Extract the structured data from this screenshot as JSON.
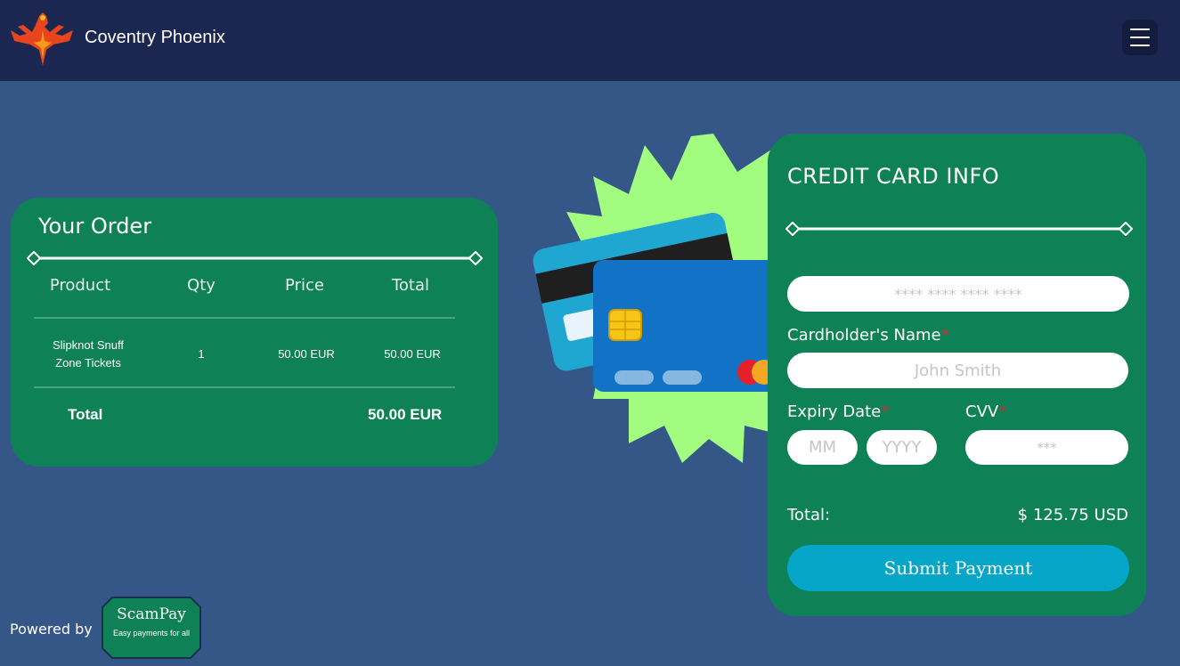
{
  "header": {
    "brand_name": "Coventry Phoenix",
    "logo_icon": "phoenix-logo",
    "menu_icon": "hamburger-menu-icon"
  },
  "order": {
    "title": "Your Order",
    "columns": [
      "Product",
      "Qty",
      "Price",
      "Total"
    ],
    "items": [
      {
        "product": "Slipknot Snuff Zone Tickets",
        "qty": "1",
        "price": "50.00 EUR",
        "total": "50.00 EUR"
      }
    ],
    "total_label": "Total",
    "total_value": "50.00 EUR"
  },
  "payment": {
    "title": "CREDIT CARD INFO",
    "card_number_placeholder": "**** **** **** ****",
    "cardholder_label": "Cardholder's Name",
    "cardholder_placeholder": "John Smith",
    "expiry_label": "Expiry Date",
    "month_placeholder": "MM",
    "year_placeholder": "YYYY",
    "cvv_label": "CVV",
    "cvv_placeholder": "***",
    "required_marker": "*",
    "total_label": "Total:",
    "total_value": "$ 125.75 USD",
    "submit_label": "Submit Payment"
  },
  "footer": {
    "powered_by": "Powered by",
    "provider_name": "ScamPay",
    "provider_tagline": "Easy payments for all"
  },
  "colors": {
    "page_background": "#355787",
    "header_background": "#1c2751",
    "card_green": "#0f8157",
    "button_cyan": "#06a6c9",
    "burst_green": "#a1fc7f",
    "required_red": "#e0262b"
  }
}
